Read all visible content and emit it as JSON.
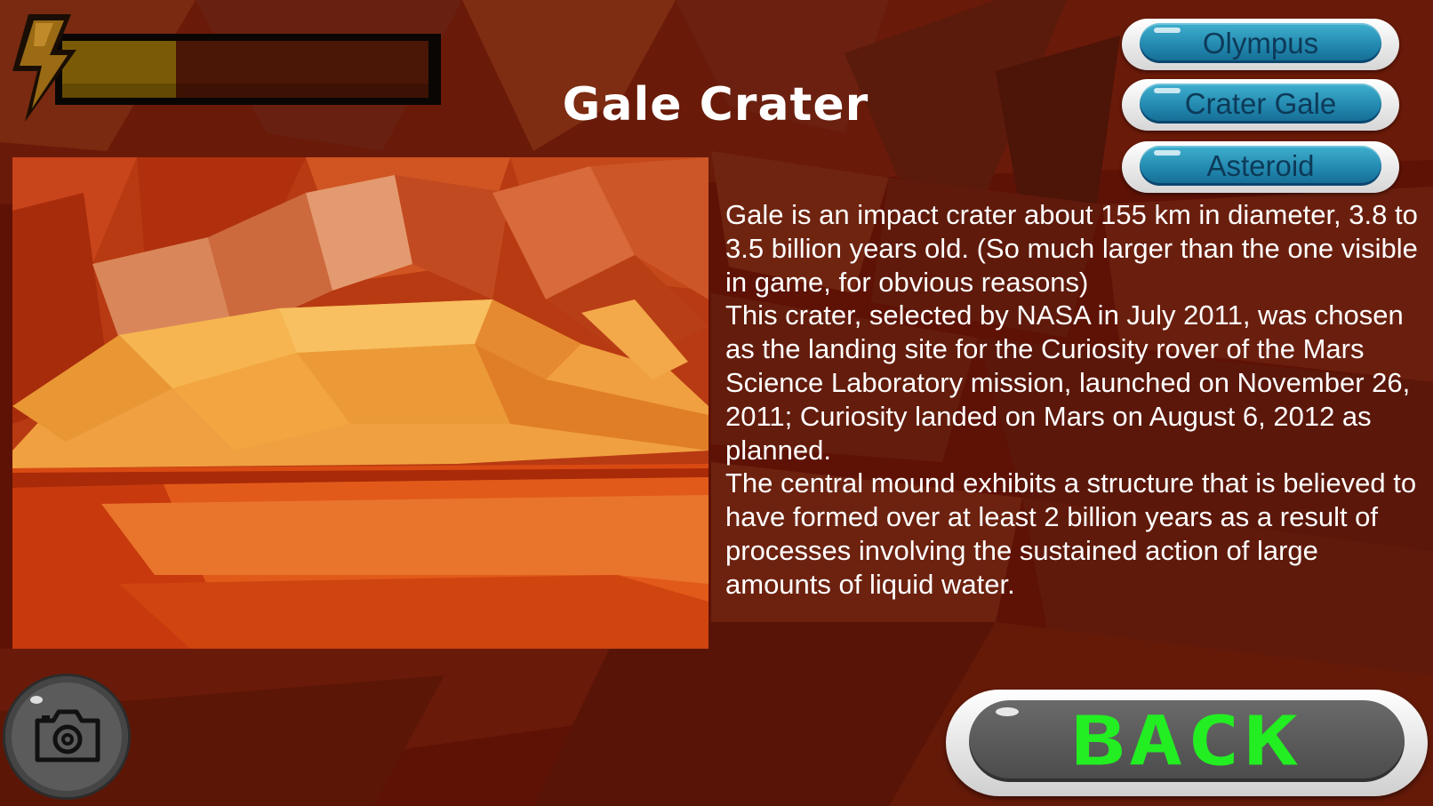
{
  "energy": {
    "level": 0.31,
    "icon": "lightning-bolt-icon"
  },
  "title": "Gale Crater",
  "description": {
    "paragraphs": [
      "Gale is an impact crater about 155 km in diameter, 3.8 to 3.5 billion years old. (So much larger than the one visible in game, for obvious reasons)",
      "This crater, selected by NASA in July 2011, was chosen as the landing site for the Curiosity rover of the Mars Science Laboratory mission, launched on November 26, 2011; Curiosity landed on Mars on August 6, 2012 as planned.",
      "The central mound exhibits a structure that is believed to have formed over at least 2 billion years as a result of processes involving the sustained action of large amounts of liquid water."
    ]
  },
  "locations": [
    {
      "label": "Olympus"
    },
    {
      "label": "Crater Gale"
    },
    {
      "label": "Asteroid"
    }
  ],
  "camera_button": {
    "icon": "camera-icon"
  },
  "back_button": {
    "label": "BACK"
  },
  "colors": {
    "background": "#5a0f04",
    "energy_fill": "#7a5a06",
    "location_button": "#1d7fa7",
    "back_text": "#22ee22"
  }
}
